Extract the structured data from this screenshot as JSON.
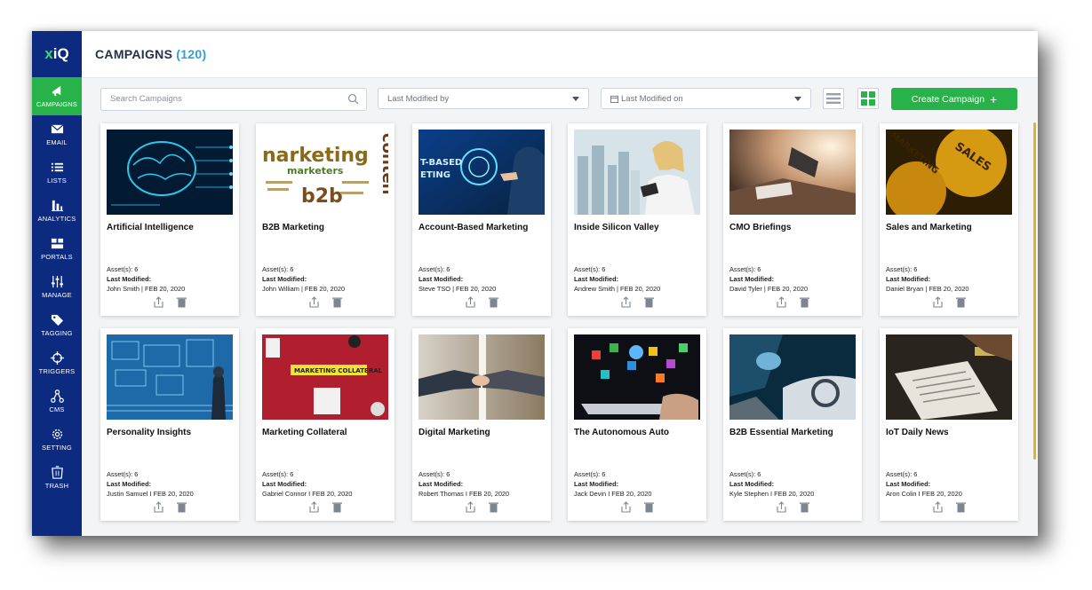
{
  "app": {
    "logo_prefix": "x",
    "logo_suffix": "iQ"
  },
  "sidebar": {
    "items": [
      {
        "label": "CAMPAIGNS",
        "icon": "megaphone-icon"
      },
      {
        "label": "EMAIL",
        "icon": "envelope-icon"
      },
      {
        "label": "LISTS",
        "icon": "list-icon"
      },
      {
        "label": "ANALYTICS",
        "icon": "bar-chart-icon"
      },
      {
        "label": "PORTALS",
        "icon": "grid-icon"
      },
      {
        "label": "MANAGE",
        "icon": "sliders-icon"
      },
      {
        "label": "TAGGING",
        "icon": "tag-icon"
      },
      {
        "label": "TRIGGERS",
        "icon": "crosshair-icon"
      },
      {
        "label": "CMS",
        "icon": "hierarchy-icon"
      },
      {
        "label": "SETTING",
        "icon": "gear-icon"
      },
      {
        "label": "TRASH",
        "icon": "trash-icon"
      }
    ]
  },
  "header": {
    "title": "CAMPAIGNS",
    "count": "(120)"
  },
  "toolbar": {
    "search_placeholder": "Search Campaigns",
    "modified_by": "Last Modified by",
    "modified_on": "Last Modified on",
    "create_label": "Create Campaign"
  },
  "campaigns": [
    {
      "title": "Artificial Intelligence",
      "assets": "Asset(s): 6",
      "modified_label": "Last Modified:",
      "modified_value": "John Smith | FEB 20, 2020"
    },
    {
      "title": "B2B Marketing",
      "assets": "Asset(s): 6",
      "modified_label": "Last Modified:",
      "modified_value": "John William | FEB 20, 2020"
    },
    {
      "title": "Account-Based Marketing",
      "assets": "Asset(s): 6",
      "modified_label": "Last Modified:",
      "modified_value": "Steve TSO | FEB 20, 2020"
    },
    {
      "title": "Inside Silicon Valley",
      "assets": "Asset(s): 6",
      "modified_label": "Last Modified:",
      "modified_value": "Andrew Smith | FEB 20, 2020"
    },
    {
      "title": "CMO Briefings",
      "assets": "Asset(s): 6",
      "modified_label": "Last Modified:",
      "modified_value": "David Tyler | FEB 20, 2020"
    },
    {
      "title": "Sales and Marketing",
      "assets": "Asset(s): 6",
      "modified_label": "Last Modified:",
      "modified_value": "Daniel Bryan | FEB 20, 2020"
    },
    {
      "title": "Personality Insights",
      "assets": "Asset(s): 6",
      "modified_label": "Last Modified:",
      "modified_value": "Justin Samuel I FEB 20, 2020"
    },
    {
      "title": "Marketing Collateral",
      "assets": "Asset(s): 6",
      "modified_label": "Last Modified:",
      "modified_value": "Gabriel Connor I FEB 20, 2020"
    },
    {
      "title": "Digital Marketing",
      "assets": "Asset(s): 6",
      "modified_label": "Last Modified:",
      "modified_value": "Robert Thomas I FEB 20, 2020"
    },
    {
      "title": "The Autonomous Auto",
      "assets": "Asset(s): 6",
      "modified_label": "Last Modified:",
      "modified_value": "Jack Devin I FEB 20, 2020"
    },
    {
      "title": "B2B Essential Marketing",
      "assets": "Asset(s): 6",
      "modified_label": "Last Modified:",
      "modified_value": "Kyle Stephen I FEB 20, 2020"
    },
    {
      "title": "IoT Daily News",
      "assets": "Asset(s): 6",
      "modified_label": "Last Modified:",
      "modified_value": "Aron Colin I FEB 20, 2020"
    }
  ],
  "thumb_text": {
    "b2b_word": "narketing",
    "b2b_sub": "marketers",
    "b2b_b2b": "b2b",
    "b2b_vertical": "conten",
    "abm_text": "T-BASED",
    "abm_text2": "ETING",
    "sales_text": "SALES",
    "sales_text2": "MARKETING",
    "collateral_text": "MARKETING COLLATERAL"
  },
  "colors": {
    "sidebar": "#0b2a80",
    "accent": "#28b34a",
    "count": "#2fa0d6",
    "scroll": "#e2b12c"
  }
}
